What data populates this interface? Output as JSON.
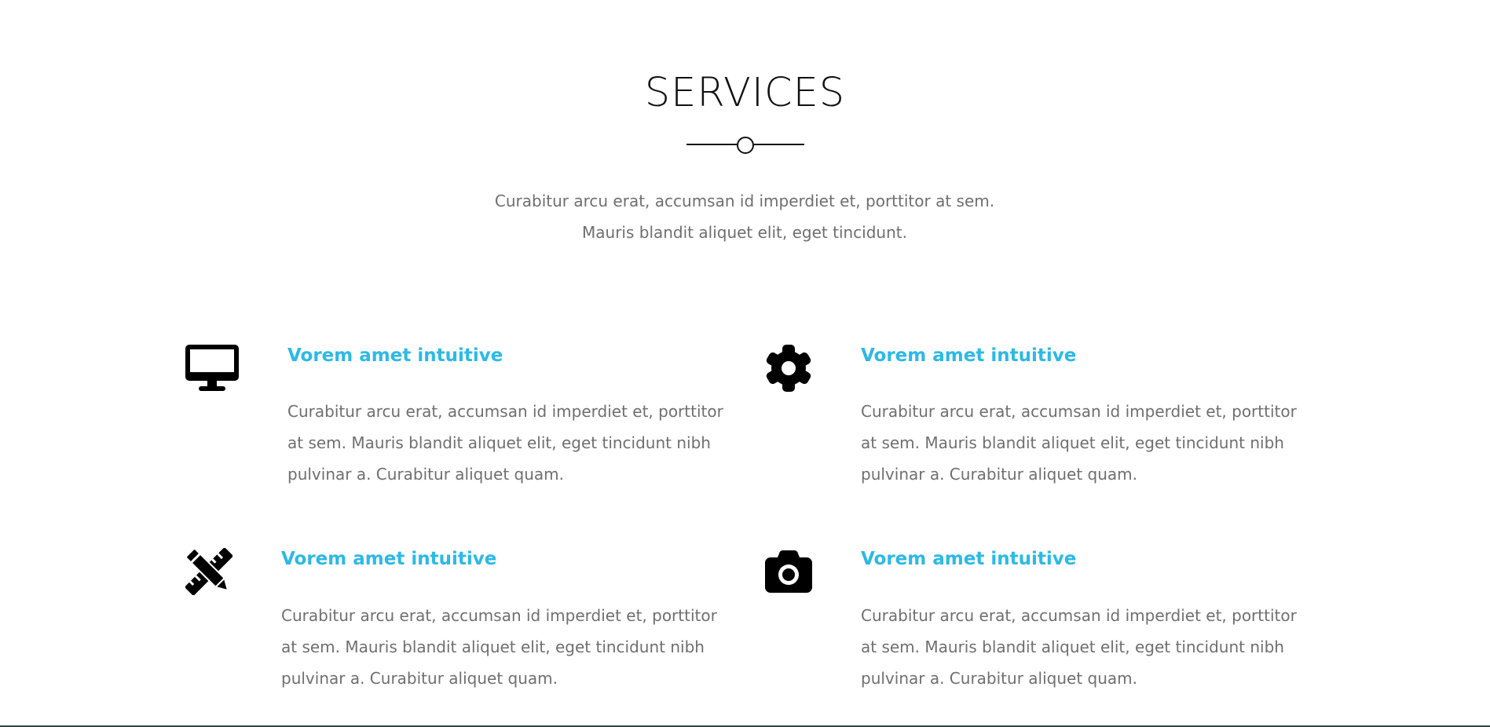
{
  "section": {
    "title": "SERVICES",
    "intro": "Curabitur arcu erat, accumsan id imperdiet et, porttitor at sem. Mauris blandit aliquet elit, eget tincidunt."
  },
  "colors": {
    "accent": "#2cb9e6",
    "heading": "#111111",
    "body_text": "#6f6f6f",
    "icon": "#000000"
  },
  "services": [
    {
      "icon": "desktop-icon",
      "title": "Vorem amet intuitive",
      "text": "Curabitur arcu erat, accumsan id imperdiet et, porttitor at sem. Mauris blandit aliquet elit, eget tincidunt nibh pulvinar a. Curabitur aliquet quam."
    },
    {
      "icon": "gear-icon",
      "title": "Vorem amet intuitive",
      "text": "Curabitur arcu erat, accumsan id imperdiet et, porttitor at sem. Mauris blandit aliquet elit, eget tincidunt nibh pulvinar a. Curabitur aliquet quam."
    },
    {
      "icon": "pencil-ruler-icon",
      "title": "Vorem amet intuitive",
      "text": "Curabitur arcu erat, accumsan id imperdiet et, porttitor at sem. Mauris blandit aliquet elit, eget tincidunt nibh pulvinar a. Curabitur aliquet quam."
    },
    {
      "icon": "camera-icon",
      "title": "Vorem amet intuitive",
      "text": "Curabitur arcu erat, accumsan id imperdiet et, porttitor at sem. Mauris blandit aliquet elit, eget tincidunt nibh pulvinar a. Curabitur aliquet quam."
    }
  ]
}
